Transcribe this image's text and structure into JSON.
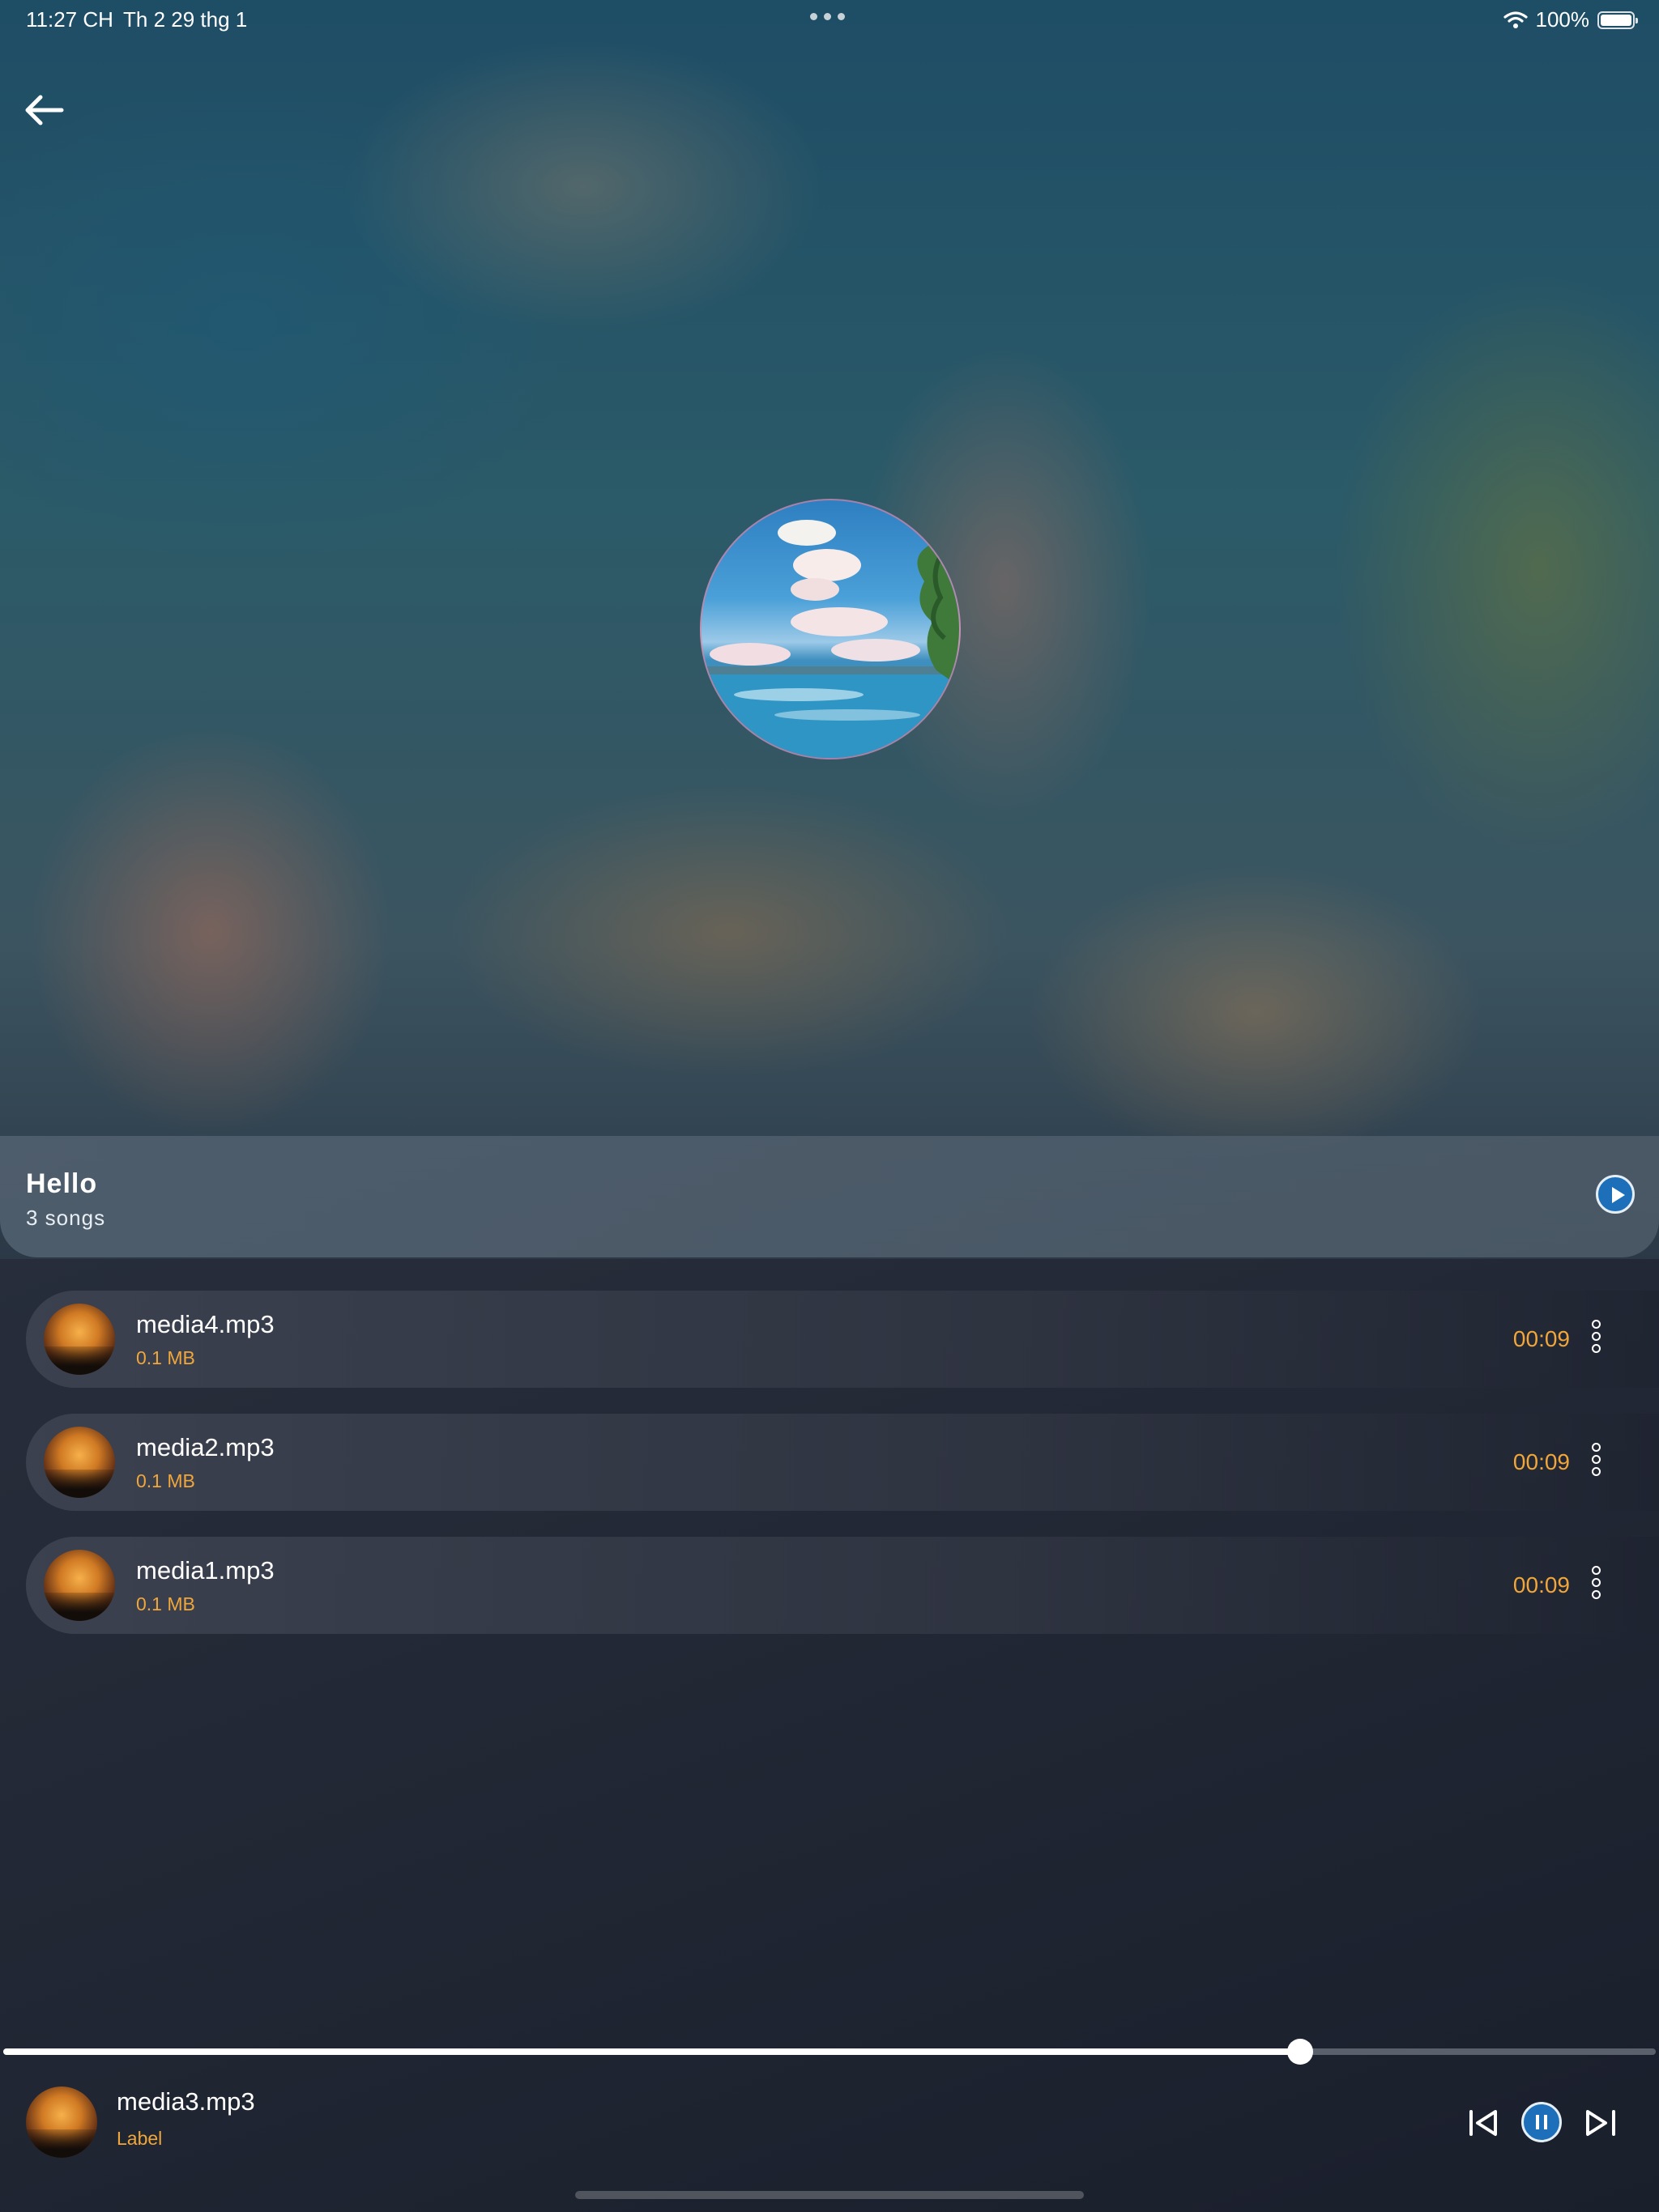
{
  "status_bar": {
    "time": "11:27 CH",
    "date": "Th 2 29 thg 1",
    "battery": "100%"
  },
  "icons": {
    "back": "arrow-left-icon",
    "play": "play-icon",
    "more": "more-vertical-icon",
    "previous": "skip-previous-icon",
    "pause": "pause-icon",
    "next": "skip-next-icon",
    "wifi": "wifi-icon",
    "battery": "battery-icon"
  },
  "colors": {
    "accent": "#f0a63a",
    "button_blue": "#1c6fb8",
    "background": "#262c39"
  },
  "playlist": {
    "title": "Hello",
    "subtitle": "3 songs"
  },
  "songs": [
    {
      "name": "media4.mp3",
      "size": "0.1 MB",
      "duration": "00:09"
    },
    {
      "name": "media2.mp3",
      "size": "0.1 MB",
      "duration": "00:09"
    },
    {
      "name": "media1.mp3",
      "size": "0.1 MB",
      "duration": "00:09"
    }
  ],
  "player": {
    "title": "media3.mp3",
    "label": "Label",
    "progress": 0.785
  }
}
